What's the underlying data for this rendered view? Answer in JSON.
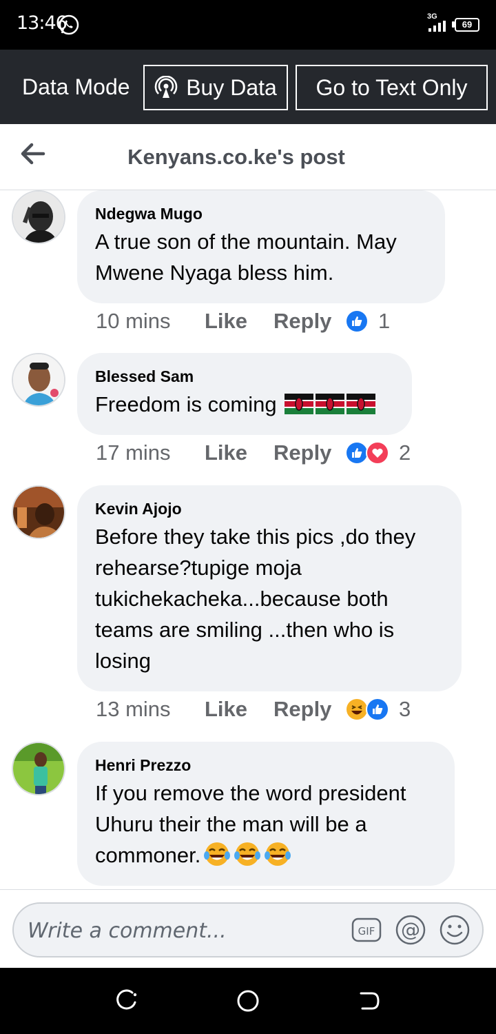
{
  "status_bar": {
    "time": "13:46",
    "network": "3G",
    "battery": "69",
    "icons": [
      "whatsapp-icon",
      "signal-icon",
      "battery-icon"
    ]
  },
  "data_bar": {
    "mode_label": "Data Mode",
    "buy_label": "Buy Data",
    "text_only_label": "Go to Text Only"
  },
  "nav": {
    "title": "Kenyans.co.ke's post"
  },
  "comments": [
    {
      "author": "Ndegwa Mugo",
      "text": "A true son of the mountain. May Mwene Nyaga bless him.",
      "time": "10 mins",
      "like": "Like",
      "reply": "Reply",
      "reactions": [
        "like"
      ],
      "reaction_count": "1"
    },
    {
      "author": "Blessed Sam",
      "text": "Freedom is coming",
      "emoji": [
        "kenya-flag",
        "kenya-flag",
        "kenya-flag"
      ],
      "time": "17 mins",
      "like": "Like",
      "reply": "Reply",
      "reactions": [
        "like",
        "love"
      ],
      "reaction_count": "2"
    },
    {
      "author": "Kevin Ajojo",
      "text": "Before they take this pics ,do they rehearse?tupige moja tukichekacheka...because both teams are smiling ...then who is losing",
      "time": "13 mins",
      "like": "Like",
      "reply": "Reply",
      "reactions": [
        "haha",
        "like"
      ],
      "reaction_count": "3"
    },
    {
      "author": "Henri Prezzo",
      "text": "If you remove the word president Uhuru their the man will be a commoner.",
      "emoji": [
        "tears-of-joy",
        "tears-of-joy",
        "tears-of-joy"
      ]
    }
  ],
  "composer": {
    "placeholder": "Write a comment...",
    "gif_label": "GIF"
  },
  "colors": {
    "like_blue": "#1877f2",
    "love_red": "#f33e58",
    "haha_yellow": "#f7b125",
    "bubble_bg": "#f0f2f5",
    "data_bar_bg": "#25282d"
  }
}
